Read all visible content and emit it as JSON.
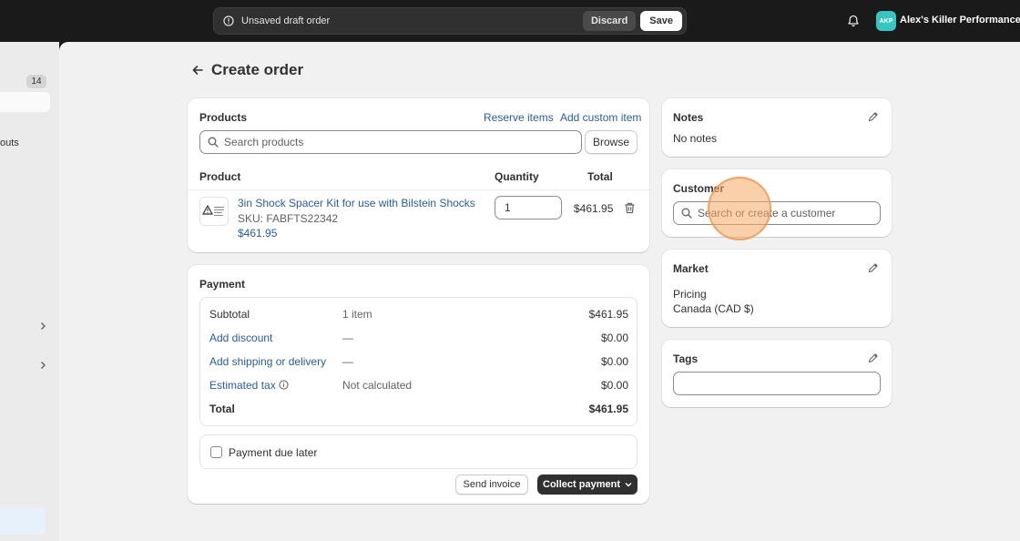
{
  "topbar": {
    "draft_text": "Unsaved draft order",
    "discard_label": "Discard",
    "save_label": "Save",
    "avatar_initials": "AKP",
    "store_name": "Alex's Killer Performance",
    "avatar_color": "#36c5c0"
  },
  "sidebar": {
    "badge_count": "14",
    "partial_label": "outs"
  },
  "page": {
    "title": "Create order"
  },
  "products": {
    "title": "Products",
    "reserve_label": "Reserve items",
    "custom_label": "Add custom item",
    "search_placeholder": "Search products",
    "browse_label": "Browse",
    "headers": {
      "product": "Product",
      "quantity": "Quantity",
      "total": "Total"
    },
    "items": [
      {
        "name": "3in Shock Spacer Kit for use with Bilstein Shocks",
        "sku": "SKU: FABFTS22342",
        "price": "$461.95",
        "quantity": "1",
        "total": "$461.95"
      }
    ]
  },
  "payment": {
    "title": "Payment",
    "rows": [
      {
        "label": "Subtotal",
        "detail": "1 item",
        "amount": "$461.95"
      },
      {
        "label": "Add discount",
        "detail": "—",
        "amount": "$0.00"
      },
      {
        "label": "Add shipping or delivery",
        "detail": "—",
        "amount": "$0.00"
      },
      {
        "label": "Estimated tax",
        "detail": "Not calculated",
        "amount": "$0.00"
      },
      {
        "label": "Total",
        "detail": "",
        "amount": "$461.95"
      }
    ],
    "due_later_label": "Payment due later",
    "send_invoice_label": "Send invoice",
    "collect_label": "Collect payment"
  },
  "notes": {
    "title": "Notes",
    "text": "No notes"
  },
  "customer": {
    "title": "Customer",
    "search_placeholder": "Search or create a customer"
  },
  "market": {
    "title": "Market",
    "line1": "Pricing",
    "line2": "Canada (CAD $)"
  },
  "tags": {
    "title": "Tags",
    "value": ""
  },
  "colors": {
    "link": "#2a5c9e",
    "primary_button": "#303030",
    "topbar": "#1a1a1a",
    "background": "#f1f1f1"
  }
}
